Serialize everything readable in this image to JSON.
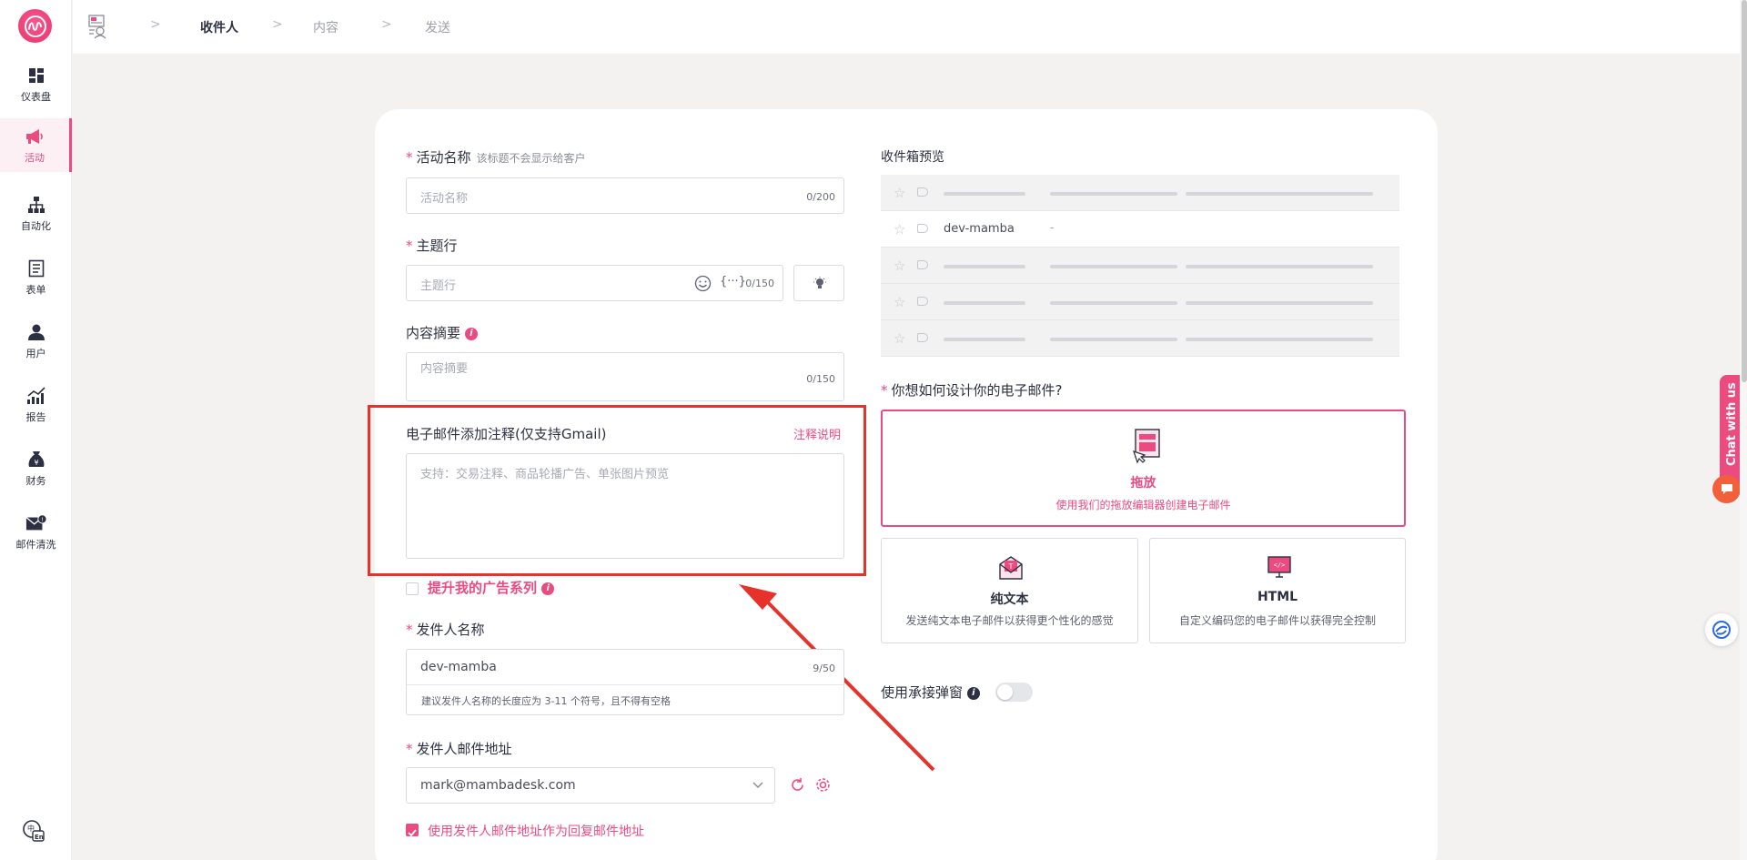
{
  "sidebar": {
    "items": [
      {
        "label": "仪表盘",
        "icon": "dashboard-icon"
      },
      {
        "label": "活动",
        "icon": "megaphone-icon"
      },
      {
        "label": "自动化",
        "icon": "hierarchy-icon"
      },
      {
        "label": "表单",
        "icon": "form-icon"
      },
      {
        "label": "用户",
        "icon": "user-icon"
      },
      {
        "label": "报告",
        "icon": "report-icon"
      },
      {
        "label": "财务",
        "icon": "money-bag-icon"
      },
      {
        "label": "邮件清洗",
        "icon": "mail-clean-icon"
      }
    ],
    "active_index": 1,
    "lang_icon": "language-icon"
  },
  "breadcrumb": {
    "steps": [
      "收件人",
      "内容",
      "发送"
    ],
    "active_index": 0
  },
  "form": {
    "campaign_name": {
      "label": "活动名称",
      "hint": "该标题不会显示给客户",
      "placeholder": "活动名称",
      "counter": "0/200"
    },
    "subject": {
      "label": "主题行",
      "placeholder": "主题行",
      "counter": "0/150"
    },
    "preheader": {
      "label": "内容摘要",
      "placeholder": "内容摘要",
      "counter": "0/150"
    },
    "annotation": {
      "label": "电子邮件添加注释(仅支持Gmail)",
      "link": "注释说明",
      "placeholder": "支持：交易注释、商品轮播广告、单张图片预览"
    },
    "promote": {
      "label": "提升我的广告系列"
    },
    "sender_name": {
      "label": "发件人名称",
      "value": "dev-mamba",
      "counter": "9/50",
      "help": "建议发件人名称的长度应为 3-11 个符号，且不得有空格"
    },
    "sender_email": {
      "label": "发件人邮件地址",
      "value": "mark@mambadesk.com"
    },
    "reply_to": {
      "label": "使用发件人邮件地址作为回复邮件地址",
      "checked": true
    }
  },
  "preview": {
    "title": "收件箱预览",
    "sender": "dev-mamba",
    "snippet": "-"
  },
  "design": {
    "question": "你想如何设计你的电子邮件?",
    "options": [
      {
        "title": "拖放",
        "desc": "使用我们的拖放编辑器创建电子邮件",
        "selected": true
      },
      {
        "title": "纯文本",
        "desc": "发送纯文本电子邮件以获得更个性化的感觉",
        "selected": false
      },
      {
        "title": "HTML",
        "desc": "自定义编码您的电子邮件以获得完全控制",
        "selected": false
      }
    ]
  },
  "popup": {
    "label": "使用承接弹窗",
    "enabled": false
  },
  "chat": {
    "label": "Chat with us"
  },
  "colors": {
    "accent": "#ec4b80",
    "highlight": "#e5332a",
    "text": "#2d3042"
  }
}
